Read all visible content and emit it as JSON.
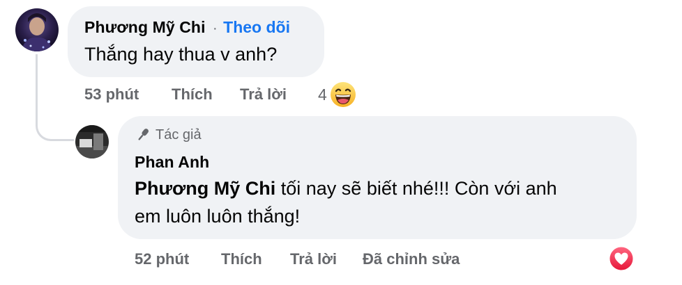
{
  "comment": {
    "author": "Phương Mỹ Chi",
    "separator": "·",
    "follow_label": "Theo dõi",
    "text": "Thắng hay thua v anh?",
    "time": "53 phút",
    "like_label": "Thích",
    "reply_label": "Trả lời",
    "reaction_count": "4",
    "reaction_icon": "haha-emoji-icon"
  },
  "reply": {
    "badge_icon": "microphone-icon",
    "badge_label": "Tác giả",
    "author": "Phan Anh",
    "mention": "Phương Mỹ Chi",
    "text_line1": " tối nay sẽ biết nhé!!! Còn với anh",
    "text_line2": "em luôn luôn thắng!",
    "time": "52 phút",
    "like_label": "Thích",
    "reply_label": "Trả lời",
    "edited_label": "Đã chỉnh sửa",
    "reaction_icon": "love-reaction-icon"
  },
  "colors": {
    "bubble": "#f0f2f5",
    "link": "#1877f2",
    "secondary_text": "#65676b",
    "love": "#f33e58"
  }
}
